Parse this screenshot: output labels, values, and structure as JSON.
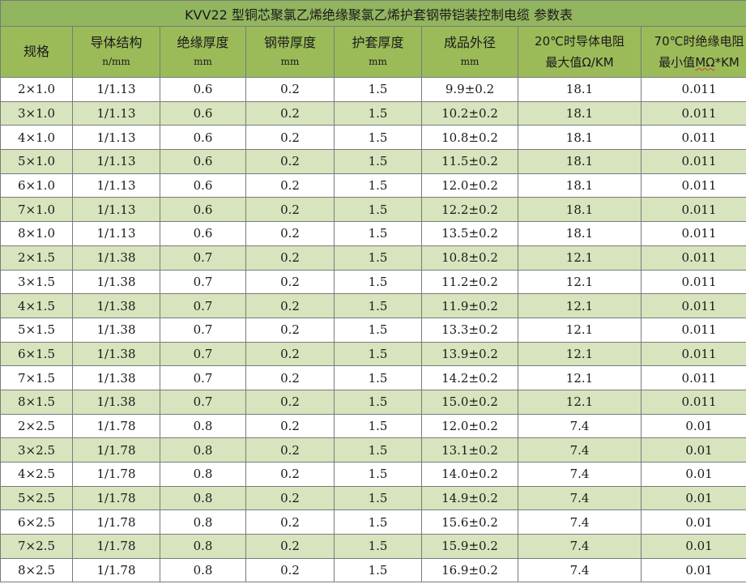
{
  "title": "KVV22 型铜芯聚氯乙烯绝缘聚氯乙烯护套钢带铠装控制电缆 参数表",
  "headers": [
    {
      "label": "规格",
      "unit": ""
    },
    {
      "label": "导体结构",
      "unit": "n/mm"
    },
    {
      "label": "绝缘厚度",
      "unit": "mm"
    },
    {
      "label": "钢带厚度",
      "unit": "mm"
    },
    {
      "label": "护套厚度",
      "unit": "mm"
    },
    {
      "label": "成品外径",
      "unit": "mm"
    },
    {
      "line1": "20℃时导体电阻",
      "line2": "最大值Ω/KM"
    },
    {
      "line1": "70℃时绝缘电阻",
      "line2_prefix": "最小值",
      "line2_wavy": "MΩ",
      "line2_suffix": "*KM"
    }
  ],
  "rows": [
    [
      "2×1.0",
      "1/1.13",
      "0.6",
      "0.2",
      "1.5",
      "9.9±0.2",
      "18.1",
      "0.011"
    ],
    [
      "3×1.0",
      "1/1.13",
      "0.6",
      "0.2",
      "1.5",
      "10.2±0.2",
      "18.1",
      "0.011"
    ],
    [
      "4×1.0",
      "1/1.13",
      "0.6",
      "0.2",
      "1.5",
      "10.8±0.2",
      "18.1",
      "0.011"
    ],
    [
      "5×1.0",
      "1/1.13",
      "0.6",
      "0.2",
      "1.5",
      "11.5±0.2",
      "18.1",
      "0.011"
    ],
    [
      "6×1.0",
      "1/1.13",
      "0.6",
      "0.2",
      "1.5",
      "12.0±0.2",
      "18.1",
      "0.011"
    ],
    [
      "7×1.0",
      "1/1.13",
      "0.6",
      "0.2",
      "1.5",
      "12.2±0.2",
      "18.1",
      "0.011"
    ],
    [
      "8×1.0",
      "1/1.13",
      "0.6",
      "0.2",
      "1.5",
      "13.5±0.2",
      "18.1",
      "0.011"
    ],
    [
      "2×1.5",
      "1/1.38",
      "0.7",
      "0.2",
      "1.5",
      "10.8±0.2",
      "12.1",
      "0.011"
    ],
    [
      "3×1.5",
      "1/1.38",
      "0.7",
      "0.2",
      "1.5",
      "11.2±0.2",
      "12.1",
      "0.011"
    ],
    [
      "4×1.5",
      "1/1.38",
      "0.7",
      "0.2",
      "1.5",
      "11.9±0.2",
      "12.1",
      "0.011"
    ],
    [
      "5×1.5",
      "1/1.38",
      "0.7",
      "0.2",
      "1.5",
      "13.3±0.2",
      "12.1",
      "0.011"
    ],
    [
      "6×1.5",
      "1/1.38",
      "0.7",
      "0.2",
      "1.5",
      "13.9±0.2",
      "12.1",
      "0.011"
    ],
    [
      "7×1.5",
      "1/1.38",
      "0.7",
      "0.2",
      "1.5",
      "14.2±0.2",
      "12.1",
      "0.011"
    ],
    [
      "8×1.5",
      "1/1.38",
      "0.7",
      "0.2",
      "1.5",
      "15.0±0.2",
      "12.1",
      "0.011"
    ],
    [
      "2×2.5",
      "1/1.78",
      "0.8",
      "0.2",
      "1.5",
      "12.0±0.2",
      "7.4",
      "0.01"
    ],
    [
      "3×2.5",
      "1/1.78",
      "0.8",
      "0.2",
      "1.5",
      "13.1±0.2",
      "7.4",
      "0.01"
    ],
    [
      "4×2.5",
      "1/1.78",
      "0.8",
      "0.2",
      "1.5",
      "14.0±0.2",
      "7.4",
      "0.01"
    ],
    [
      "5×2.5",
      "1/1.78",
      "0.8",
      "0.2",
      "1.5",
      "14.9±0.2",
      "7.4",
      "0.01"
    ],
    [
      "6×2.5",
      "1/1.78",
      "0.8",
      "0.2",
      "1.5",
      "15.6±0.2",
      "7.4",
      "0.01"
    ],
    [
      "7×2.5",
      "1/1.78",
      "0.8",
      "0.2",
      "1.5",
      "15.9±0.2",
      "7.4",
      "0.01"
    ],
    [
      "8×2.5",
      "1/1.78",
      "0.8",
      "0.2",
      "1.5",
      "16.9±0.2",
      "7.4",
      "0.01"
    ]
  ],
  "colors": {
    "title_bg": "#92b55f",
    "header_bg": "#9bbb59",
    "stripe": "#d7e4bd",
    "border": "#7a7a7a"
  }
}
